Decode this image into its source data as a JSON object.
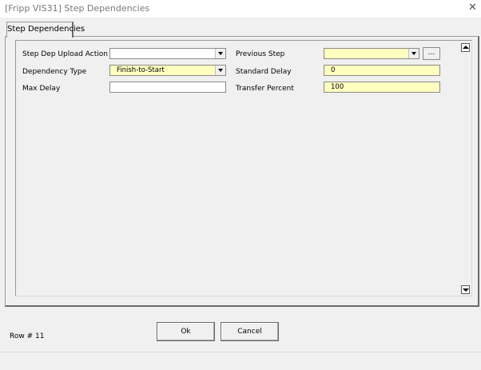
{
  "window": {
    "title": "[Fripp VIS31] Step Dependencies",
    "close_label": "✕"
  },
  "tabs": [
    {
      "label": "Step Dependencies",
      "active": true
    }
  ],
  "form": {
    "step_dep_upload_action": {
      "label": "Step Dep Upload Action",
      "value": ""
    },
    "dependency_type": {
      "label": "Dependency Type",
      "value": "Finish-to-Start"
    },
    "max_delay": {
      "label": "Max Delay",
      "value": ""
    },
    "previous_step": {
      "label": "Previous Step",
      "value": "",
      "lookup_label": "..."
    },
    "standard_delay": {
      "label": "Standard Delay",
      "value": "0"
    },
    "transfer_percent": {
      "label": "Transfer Percent",
      "value": "100"
    }
  },
  "buttons": {
    "ok": "Ok",
    "cancel": "Cancel"
  },
  "status": {
    "row": "Row # 11"
  },
  "colors": {
    "required_field": "#ffffc0",
    "background": "#f0f0f0"
  }
}
